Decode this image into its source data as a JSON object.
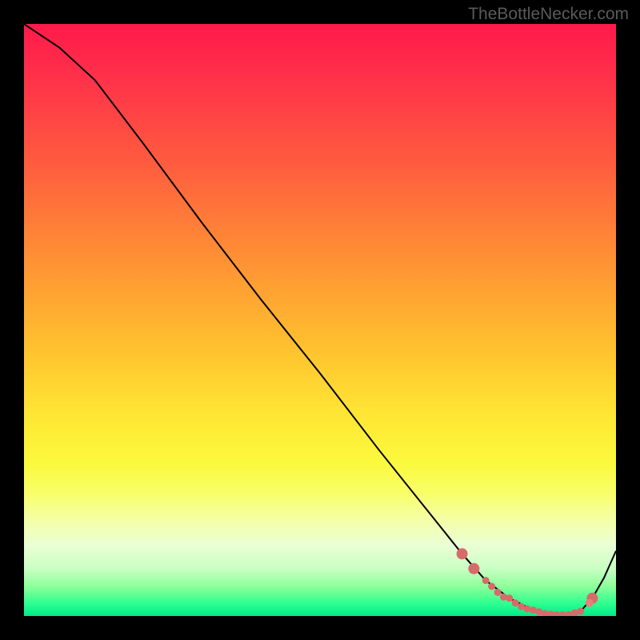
{
  "watermark": "TheBottleNecker.com",
  "chart_data": {
    "type": "line",
    "title": "",
    "xlabel": "",
    "ylabel": "",
    "xlim": [
      0,
      100
    ],
    "ylim": [
      0,
      100
    ],
    "series": [
      {
        "name": "bottleneck-curve",
        "x": [
          0,
          6,
          12,
          20,
          30,
          40,
          50,
          60,
          68,
          74,
          78,
          82,
          86,
          88,
          90,
          92,
          94,
          96,
          98,
          100
        ],
        "y": [
          100,
          96,
          90.5,
          80,
          66.5,
          53.5,
          41,
          28,
          18,
          10.5,
          6,
          3,
          1,
          0.4,
          0.2,
          0.2,
          0.8,
          3,
          6.5,
          11
        ]
      }
    ],
    "marker_cluster": {
      "name": "highlighted-range",
      "x": [
        74,
        76,
        78,
        79,
        80,
        81,
        82,
        83,
        84,
        85,
        86,
        87,
        88,
        89,
        90,
        91,
        92,
        93,
        94,
        96
      ],
      "y": [
        10.5,
        8,
        6,
        5,
        4,
        3.2,
        3,
        2.2,
        1.6,
        1.2,
        1,
        0.7,
        0.4,
        0.3,
        0.2,
        0.2,
        0.2,
        0.5,
        0.8,
        3
      ],
      "large_indices": [
        0,
        1,
        19
      ],
      "extra_points": [
        {
          "x": 95.5,
          "y": 2.2
        }
      ]
    }
  }
}
